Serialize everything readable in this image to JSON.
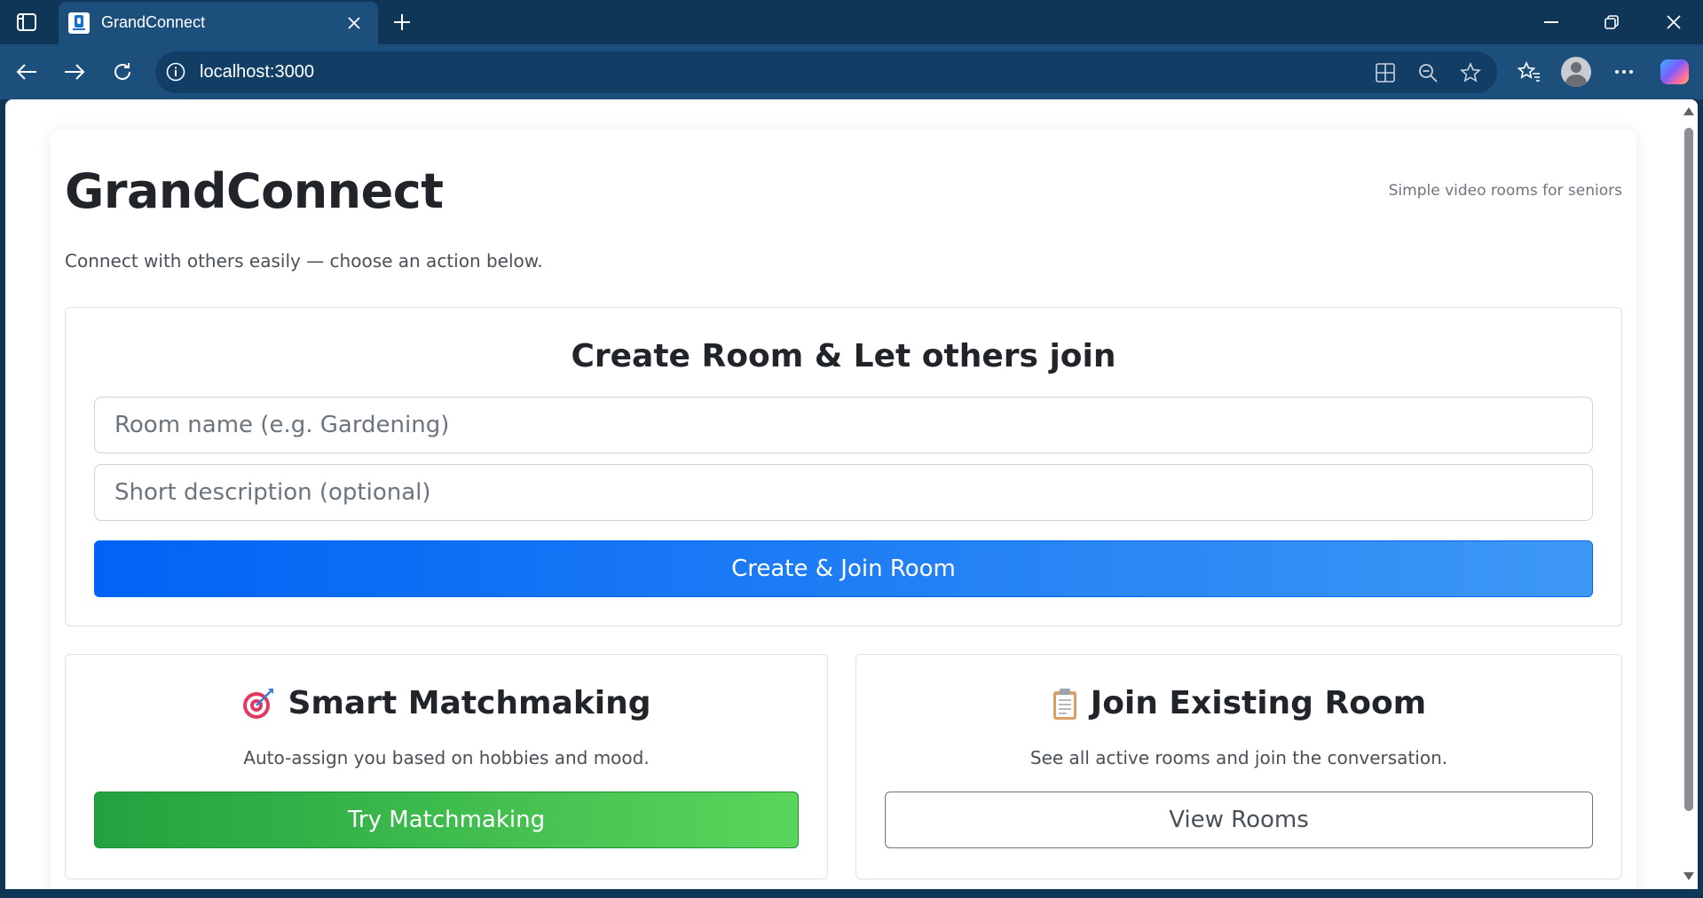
{
  "browser": {
    "tab_title": "GrandConnect",
    "url": "localhost:3000"
  },
  "page": {
    "title": "GrandConnect",
    "tagline": "Simple video rooms for seniors",
    "intro": "Connect with others easily — choose an action below."
  },
  "create_card": {
    "title": "Create Room & Let others join",
    "room_name_placeholder": "Room name (e.g. Gardening)",
    "description_placeholder": "Short description (optional)",
    "button_label": "Create & Join Room"
  },
  "match_card": {
    "icon": "target-icon",
    "title": "Smart Matchmaking",
    "subtitle": "Auto-assign you based on hobbies and mood.",
    "button_label": "Try Matchmaking"
  },
  "join_card": {
    "icon": "clipboard-icon",
    "title": "Join Existing Room",
    "subtitle": "See all active rooms and join the conversation.",
    "button_label": "View Rooms"
  },
  "colors": {
    "primary": "#0d6efd",
    "success": "#28a745",
    "chrome_dark": "#0f3557",
    "chrome_toolbar": "#1d4f7c"
  }
}
